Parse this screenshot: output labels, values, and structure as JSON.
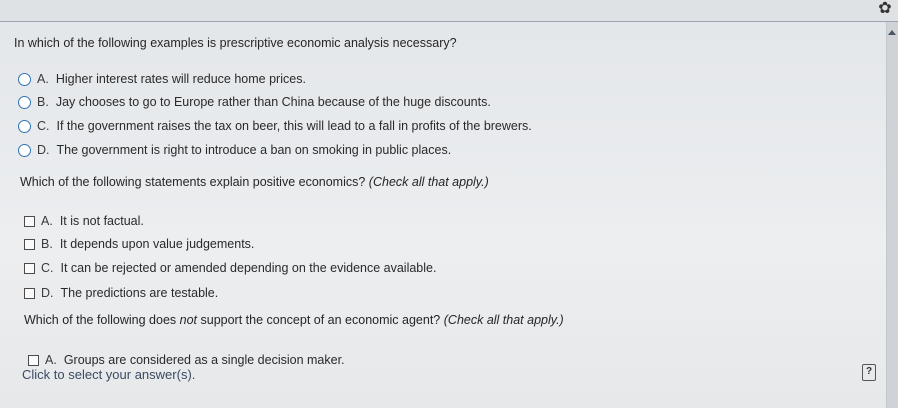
{
  "header": {
    "settings_icon": "gear-icon"
  },
  "questions": [
    {
      "prompt": "In which of the following examples is prescriptive economic analysis necessary?",
      "options": [
        {
          "letter": "A.",
          "text": "Higher interest rates will reduce home prices."
        },
        {
          "letter": "B.",
          "text": "Jay chooses to go to Europe rather than China because of the huge discounts."
        },
        {
          "letter": "C.",
          "text": "If the government raises the tax on beer, this will lead to a fall in profits of the brewers."
        },
        {
          "letter": "D.",
          "text": "The government is right to introduce a ban on smoking in public places."
        }
      ]
    },
    {
      "prompt": "Which of the following statements explain positive economics?",
      "hint": "(Check all that apply.)",
      "options": [
        {
          "letter": "A.",
          "text": "It is not factual."
        },
        {
          "letter": "B.",
          "text": "It depends upon value judgements."
        },
        {
          "letter": "C.",
          "text": "It can be rejected or amended depending on the evidence available."
        },
        {
          "letter": "D.",
          "text": "The predictions are testable."
        }
      ]
    },
    {
      "prompt_before": "Which of the following does ",
      "prompt_emph": "not",
      "prompt_after": " support the concept of an economic agent?",
      "hint": "(Check all that apply.)",
      "options": [
        {
          "letter": "A.",
          "text": "Groups are considered as a single decision maker."
        }
      ]
    }
  ],
  "status": {
    "text": "Click to select your answer(s).",
    "help_icon": "help-icon"
  }
}
